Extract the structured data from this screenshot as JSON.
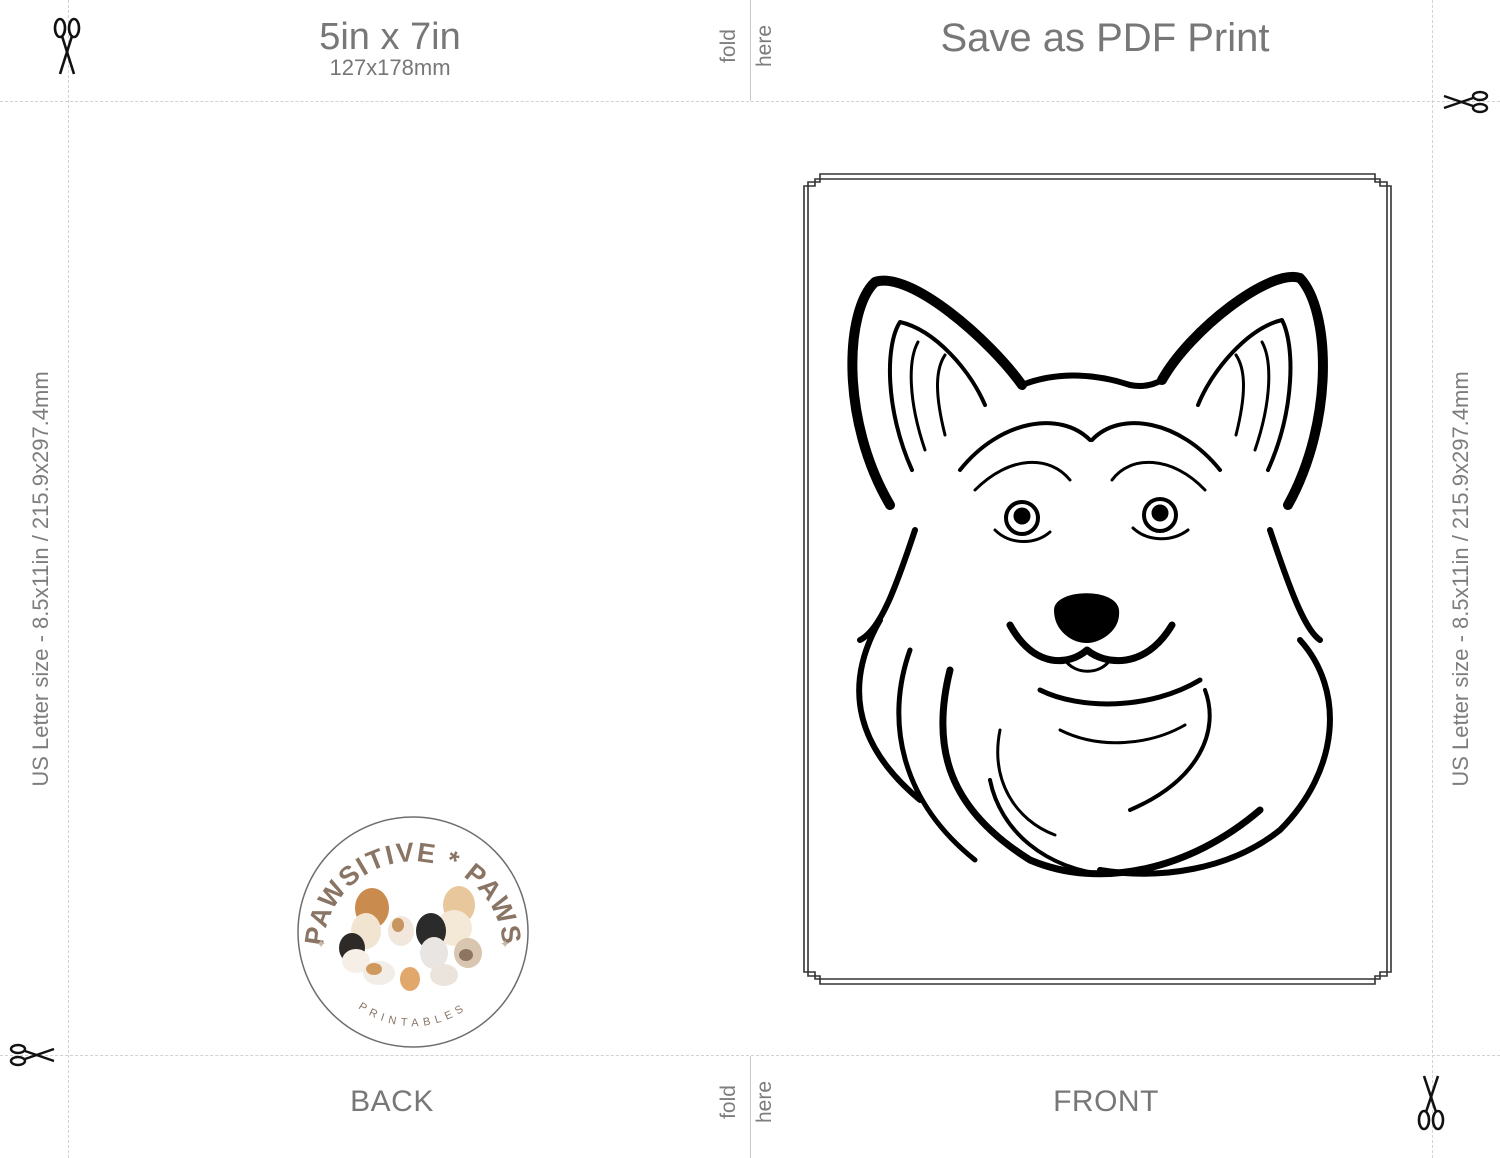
{
  "header": {
    "card_size": "5in x 7in",
    "card_size_metric": "127x178mm",
    "save_label": "Save as PDF Print"
  },
  "fold": {
    "word1": "fold",
    "word2": "here"
  },
  "paper_size": "US Letter size - 8.5x11in / 215.9x297.4mm",
  "footer": {
    "back_label": "BACK",
    "front_label": "FRONT"
  },
  "logo": {
    "top_text": "PAWSITIVE * PAWS",
    "bottom_text": "PRINTABLES",
    "accent": "#8a7565"
  },
  "icons": [
    "scissors-icon"
  ],
  "artwork": "corgi-line-art"
}
